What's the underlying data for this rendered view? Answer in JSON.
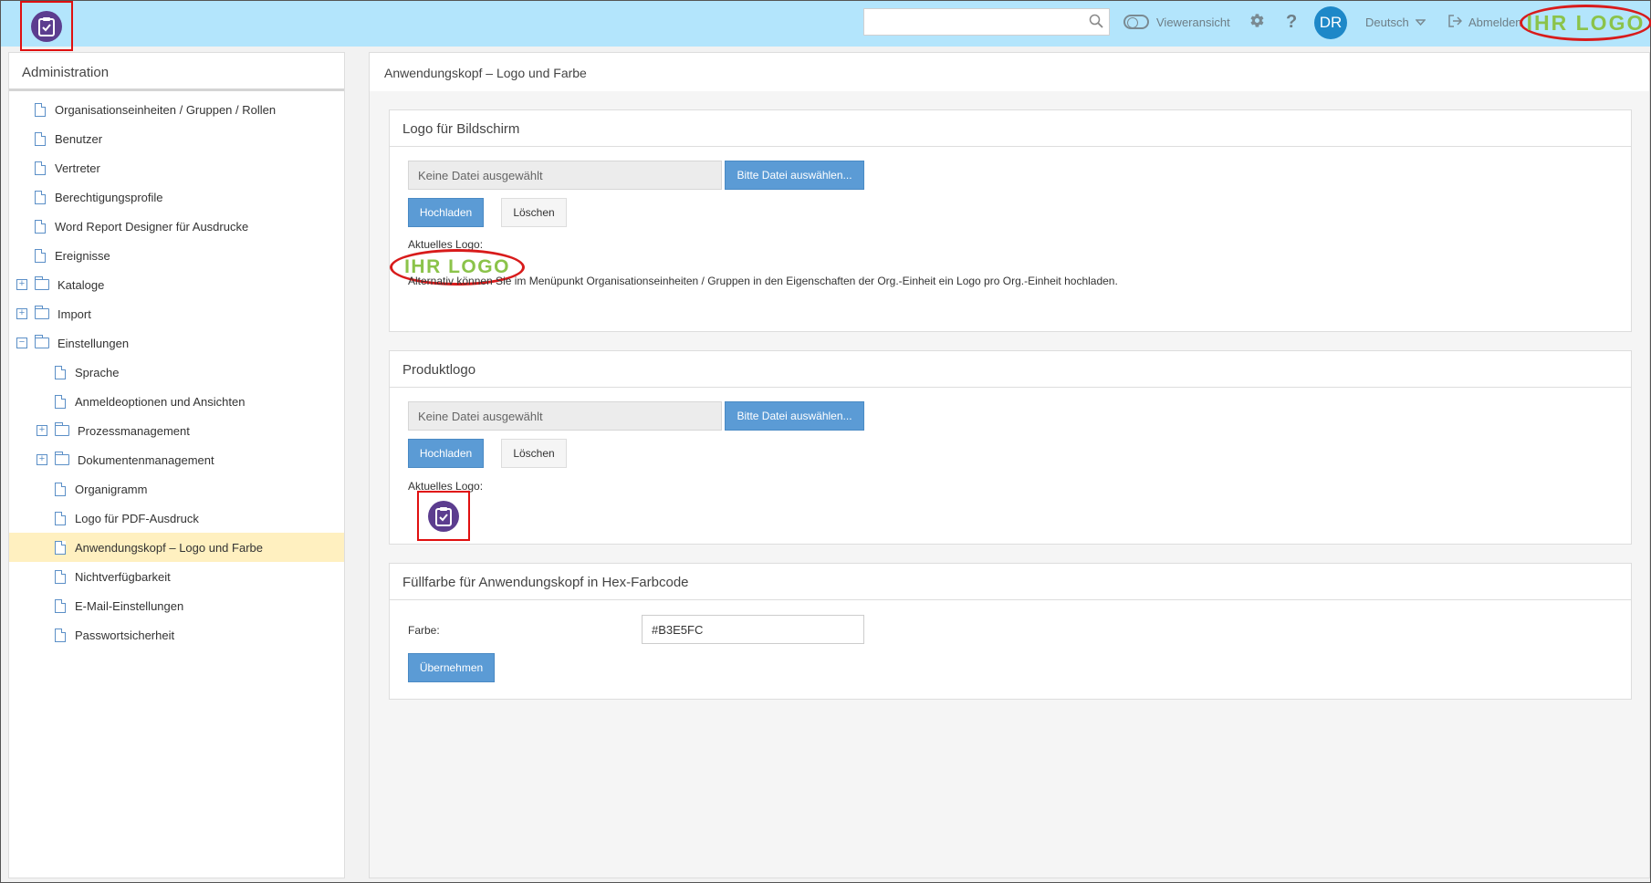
{
  "header": {
    "search_placeholder": "",
    "viewer_label": "Vieweransicht",
    "avatar_initials": "DR",
    "language": "Deutsch",
    "logout_label": "Abmelden",
    "brand_logo_text": "IHR LOGO",
    "bg_color": "#b3e5fc"
  },
  "sidebar": {
    "title": "Administration",
    "items": [
      {
        "label": "Organisationseinheiten / Gruppen / Rollen",
        "type": "file",
        "level": 0
      },
      {
        "label": "Benutzer",
        "type": "file",
        "level": 0
      },
      {
        "label": "Vertreter",
        "type": "file",
        "level": 0
      },
      {
        "label": "Berechtigungsprofile",
        "type": "file",
        "level": 0
      },
      {
        "label": "Word Report Designer für Ausdrucke",
        "type": "file",
        "level": 0
      },
      {
        "label": "Ereignisse",
        "type": "file",
        "level": 0
      },
      {
        "label": "Kataloge",
        "type": "folder",
        "level": 0,
        "expander": "+"
      },
      {
        "label": "Import",
        "type": "folder",
        "level": 0,
        "expander": "+"
      },
      {
        "label": "Einstellungen",
        "type": "folder-open",
        "level": 0,
        "expander": "−"
      },
      {
        "label": "Sprache",
        "type": "file",
        "level": 1
      },
      {
        "label": "Anmeldeoptionen und Ansichten",
        "type": "file",
        "level": 1
      },
      {
        "label": "Prozessmanagement",
        "type": "folder",
        "level": 1,
        "expander": "+"
      },
      {
        "label": "Dokumentenmanagement",
        "type": "folder",
        "level": 1,
        "expander": "+"
      },
      {
        "label": "Organigramm",
        "type": "file",
        "level": 1
      },
      {
        "label": "Logo für PDF-Ausdruck",
        "type": "file",
        "level": 1
      },
      {
        "label": "Anwendungskopf – Logo und Farbe",
        "type": "file",
        "level": 1,
        "active": true
      },
      {
        "label": "Nichtverfügbarkeit",
        "type": "file",
        "level": 1
      },
      {
        "label": "E-Mail-Einstellungen",
        "type": "file",
        "level": 1
      },
      {
        "label": "Passwortsicherheit",
        "type": "file",
        "level": 1
      }
    ]
  },
  "main": {
    "title": "Anwendungskopf – Logo und Farbe",
    "screen_logo": {
      "title": "Logo für Bildschirm",
      "file_placeholder": "Keine Datei ausgewählt",
      "choose_label": "Bitte Datei auswählen...",
      "upload_label": "Hochladen",
      "delete_label": "Löschen",
      "current_logo_label": "Aktuelles Logo:",
      "current_logo_text": "IHR LOGO",
      "info_text": "Alternativ können Sie im Menüpunkt Organisationseinheiten / Gruppen in den Eigenschaften der Org.-Einheit ein Logo pro Org.-Einheit hochladen."
    },
    "product_logo": {
      "title": "Produktlogo",
      "file_placeholder": "Keine Datei ausgewählt",
      "choose_label": "Bitte Datei auswählen...",
      "upload_label": "Hochladen",
      "delete_label": "Löschen",
      "current_logo_label": "Aktuelles Logo:"
    },
    "fill_color": {
      "title": "Füllfarbe für Anwendungskopf in Hex-Farbcode",
      "color_label": "Farbe:",
      "color_value": "#B3E5FC",
      "apply_label": "Übernehmen"
    }
  }
}
